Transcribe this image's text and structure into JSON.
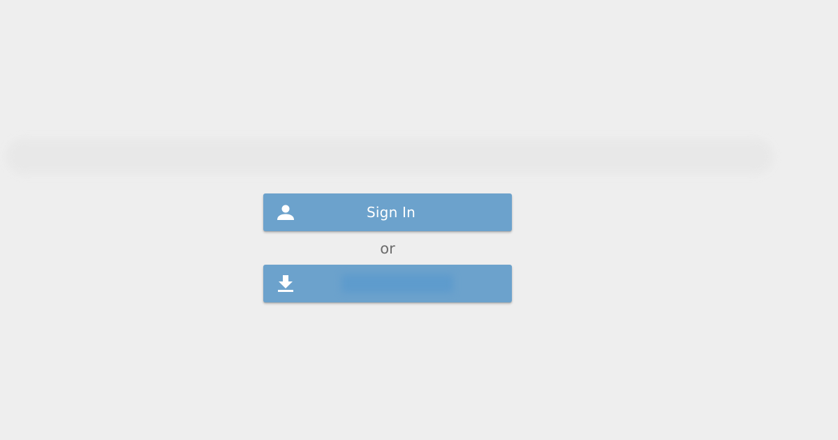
{
  "signin_button": {
    "label": "Sign In",
    "icon": "person-icon"
  },
  "separator": {
    "text": "or"
  },
  "download_button": {
    "icon": "download-icon"
  },
  "colors": {
    "background": "#eeeeee",
    "button": "#6ca2cc",
    "button_text": "#ffffff",
    "separator_text": "#6b6b6b"
  }
}
